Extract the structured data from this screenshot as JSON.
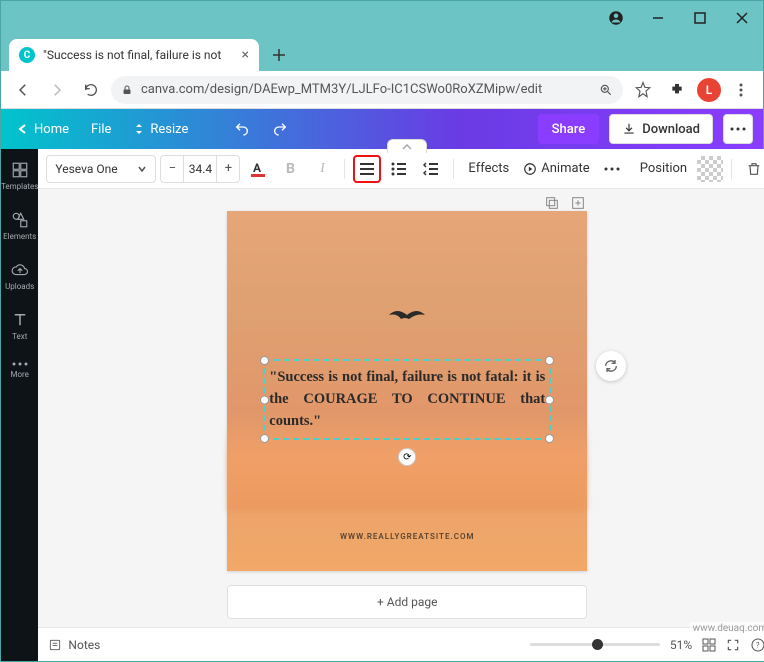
{
  "window": {
    "tab_title": "\"Success is not final, failure is not",
    "url_display": "canva.com/design/DAEwp_MTM3Y/LJLFo-IC1CSWo0RoXZMipw/edit",
    "avatar_letter": "L"
  },
  "canva_top": {
    "home": "Home",
    "file": "File",
    "resize": "Resize",
    "share": "Share",
    "download": "Download"
  },
  "sidebar": {
    "items": [
      {
        "label": "Templates"
      },
      {
        "label": "Elements"
      },
      {
        "label": "Uploads"
      },
      {
        "label": "Text"
      },
      {
        "label": "More"
      }
    ]
  },
  "toolbar": {
    "font_name": "Yeseva One",
    "font_size": "34.4",
    "effects": "Effects",
    "animate": "Animate",
    "position": "Position"
  },
  "canvas": {
    "quote_text": "\"Success is not final, failure is not fatal: it is the COURAGE TO CONTINUE that counts.\"",
    "site_text": "WWW.REALLYGREATSITE.COM",
    "add_page": "+ Add page"
  },
  "bottom": {
    "notes": "Notes",
    "zoom": "51%"
  },
  "watermark": "www.deuaq.com"
}
